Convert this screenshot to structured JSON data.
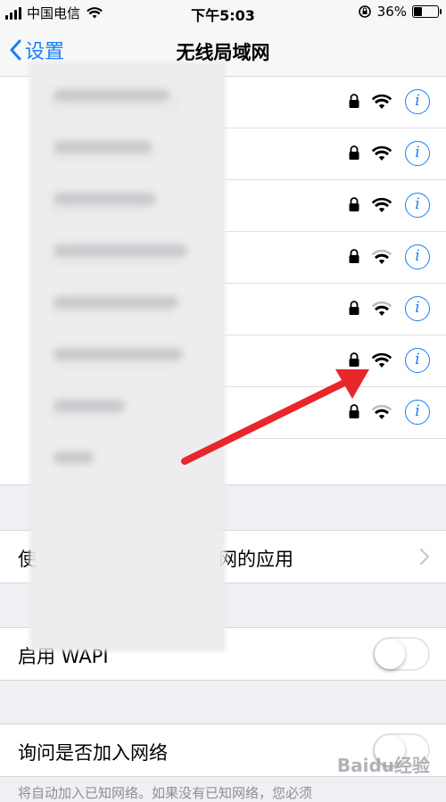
{
  "status_bar": {
    "carrier": "中国电信",
    "time": "下午5:03",
    "battery_percent": "36%",
    "battery_level": 0.36
  },
  "nav": {
    "back_label": "设置",
    "title": "无线局域网"
  },
  "networks": [
    {
      "name": "",
      "secured": true,
      "info": "i"
    },
    {
      "name": "",
      "secured": true,
      "info": "i"
    },
    {
      "name": "",
      "secured": true,
      "info": "i"
    },
    {
      "name": "",
      "secured": true,
      "info": "i"
    },
    {
      "name": "",
      "secured": true,
      "info": "i"
    },
    {
      "name": "",
      "secured": true,
      "info": "i"
    },
    {
      "name": "",
      "secured": true,
      "info": "i"
    }
  ],
  "settings": {
    "apps_row_prefix": "使",
    "apps_row_suffix": "网的应用",
    "wapi_label": "启用 WAPI",
    "wapi_enabled": false,
    "ask_join_label": "询问是否加入网络",
    "ask_join_enabled": false,
    "footer": "将自动加入已知网络。如果没有已知网络，您必须"
  },
  "colors": {
    "accent": "#1a7ef6",
    "arrow": "#e8262c",
    "background": "#efeff4"
  },
  "watermark": "Baidu经验"
}
